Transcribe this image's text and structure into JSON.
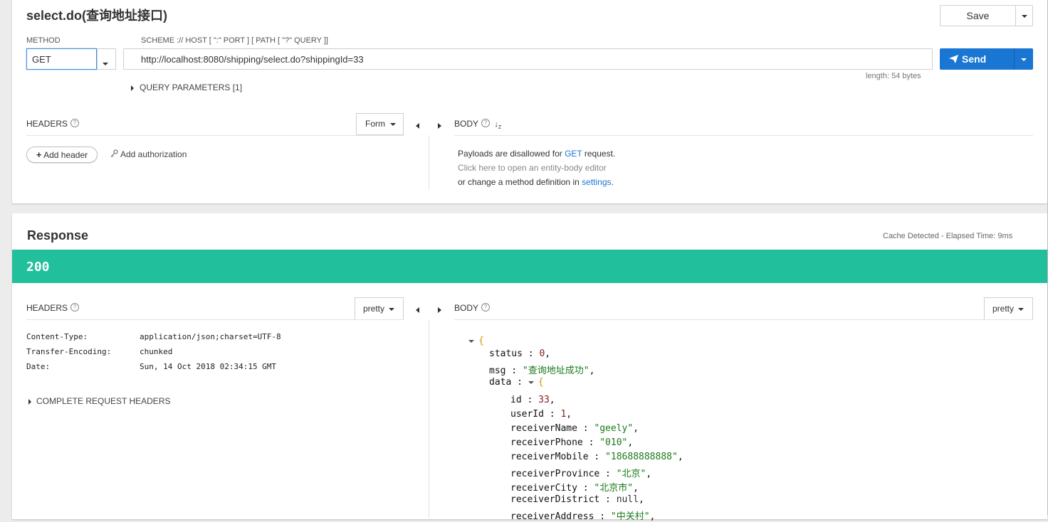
{
  "request": {
    "title": "select.do(查询地址接口)",
    "save_label": "Save",
    "method_label": "METHOD",
    "method_value": "GET",
    "url_label": "SCHEME :// HOST [ \":\" PORT ] [ PATH [ \"?\" QUERY ]]",
    "url_value": "http://localhost:8080/shipping/select.do?shippingId=33",
    "send_label": "Send",
    "length_text": "length: 54 bytes",
    "query_params_label": "QUERY PARAMETERS [1]",
    "headers_label": "HEADERS",
    "form_label": "Form",
    "add_header_label": "Add header",
    "add_authorization_label": "Add authorization",
    "body_label": "BODY",
    "body_msg_prefix": "Payloads are disallowed for",
    "body_msg_method": "GET",
    "body_msg_suffix": "request.",
    "body_click_text": "Click here to open an entity-body editor",
    "body_change_prefix": "or change a method definition in",
    "body_change_link": "settings",
    "body_change_suffix": "."
  },
  "response": {
    "title": "Response",
    "cache_text": "Cache Detected - Elapsed Time: 9ms",
    "status_code": "200",
    "status_color": "#22bf9d",
    "headers_label": "HEADERS",
    "headers_format": "pretty",
    "body_label": "BODY",
    "body_format": "pretty",
    "headers": [
      {
        "name": "Content-Type:",
        "value": "application/json;charset=UTF-8"
      },
      {
        "name": "Transfer-Encoding:",
        "value": "chunked"
      },
      {
        "name": "Date:",
        "value": "Sun, 14 Oct 2018 02:34:15 GMT"
      }
    ],
    "complete_headers_label": "COMPLETE REQUEST HEADERS",
    "json": {
      "open_brace": "{",
      "status_key": "status",
      "status_val": "0",
      "msg_key": "msg",
      "msg_val": "\"查询地址成功\"",
      "data_key": "data",
      "data_brace": "{",
      "id_key": "id",
      "id_val": "33",
      "userId_key": "userId",
      "userId_val": "1",
      "receiverName_key": "receiverName",
      "receiverName_val": "\"geely\"",
      "receiverPhone_key": "receiverPhone",
      "receiverPhone_val": "\"010\"",
      "receiverMobile_key": "receiverMobile",
      "receiverMobile_val": "\"18688888888\"",
      "receiverProvince_key": "receiverProvince",
      "receiverProvince_val": "\"北京\"",
      "receiverCity_key": "receiverCity",
      "receiverCity_val": "\"北京市\"",
      "receiverDistrict_key": "receiverDistrict",
      "receiverDistrict_val": "null",
      "receiverAddress_key": "receiverAddress",
      "receiverAddress_val": "\"中关村\""
    }
  },
  "colors": {
    "accent": "#1976d2",
    "status_ok": "#22bf9d"
  }
}
